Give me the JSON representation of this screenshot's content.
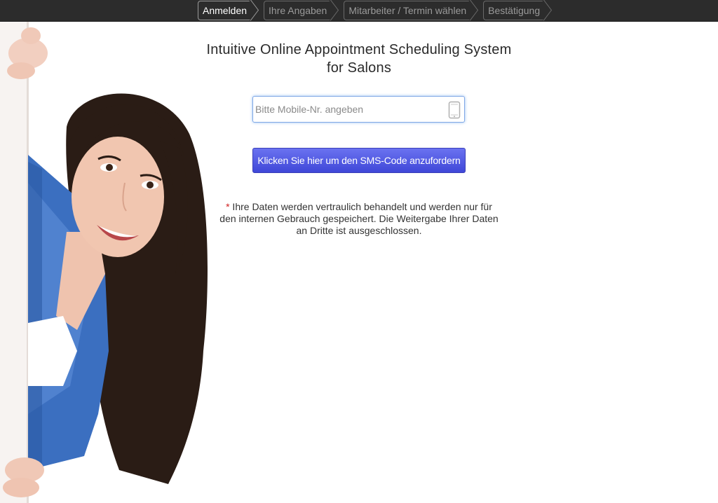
{
  "steps": [
    {
      "label": "Anmelden",
      "active": true
    },
    {
      "label": "Ihre Angaben",
      "active": false
    },
    {
      "label": "Mitarbeiter / Termin wählen",
      "active": false
    },
    {
      "label": "Bestätigung",
      "active": false
    }
  ],
  "main": {
    "title_line1": "Intuitive Online Appointment Scheduling System",
    "title_line2": "for Salons",
    "phone_placeholder": "Bitte Mobile-Nr. angeben",
    "phone_value": "",
    "sms_button_label": "Klicken Sie hier um den SMS-Code anzufordern",
    "privacy_star": "*",
    "privacy_text": " Ihre Daten werden vertraulich behandelt und werden nur für den internen Gebrauch gespeichert. Die Weitergabe Ihrer Daten an Dritte ist ausgeschlossen."
  },
  "icons": {
    "phone": "mobile-phone-icon"
  },
  "colors": {
    "topbar": "#2c2c2c",
    "button": "#4a52e0",
    "input_focus": "#7fa8e6",
    "required_star": "#d02020"
  }
}
